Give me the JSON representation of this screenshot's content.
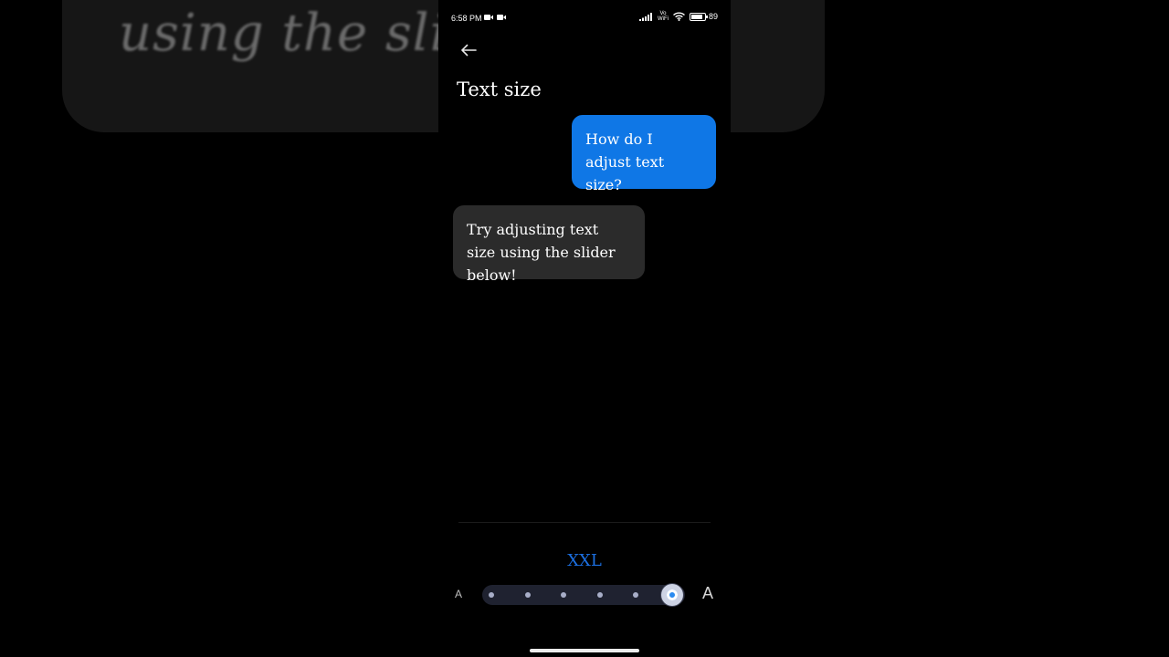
{
  "background": {
    "zoom_text": "using the sli"
  },
  "status_bar": {
    "time": "6:58 PM",
    "volte_top": "Vo",
    "volte_bottom": "WiFi",
    "battery_text": "89",
    "battery_level_percent": 89
  },
  "header": {
    "title": "Text size",
    "back_icon": "arrow-left-icon"
  },
  "messages": [
    {
      "role": "user",
      "text": "How do I adjust text size?",
      "color": "#0f77e6"
    },
    {
      "role": "reply",
      "text": "Try adjusting text size using the slider below!",
      "color": "#2b2b2b"
    }
  ],
  "text_size": {
    "current_label": "XXL",
    "small_glyph": "A",
    "large_glyph": "A",
    "steps": 6,
    "selected_step": 6,
    "accent_color": "#1c6fe0"
  }
}
